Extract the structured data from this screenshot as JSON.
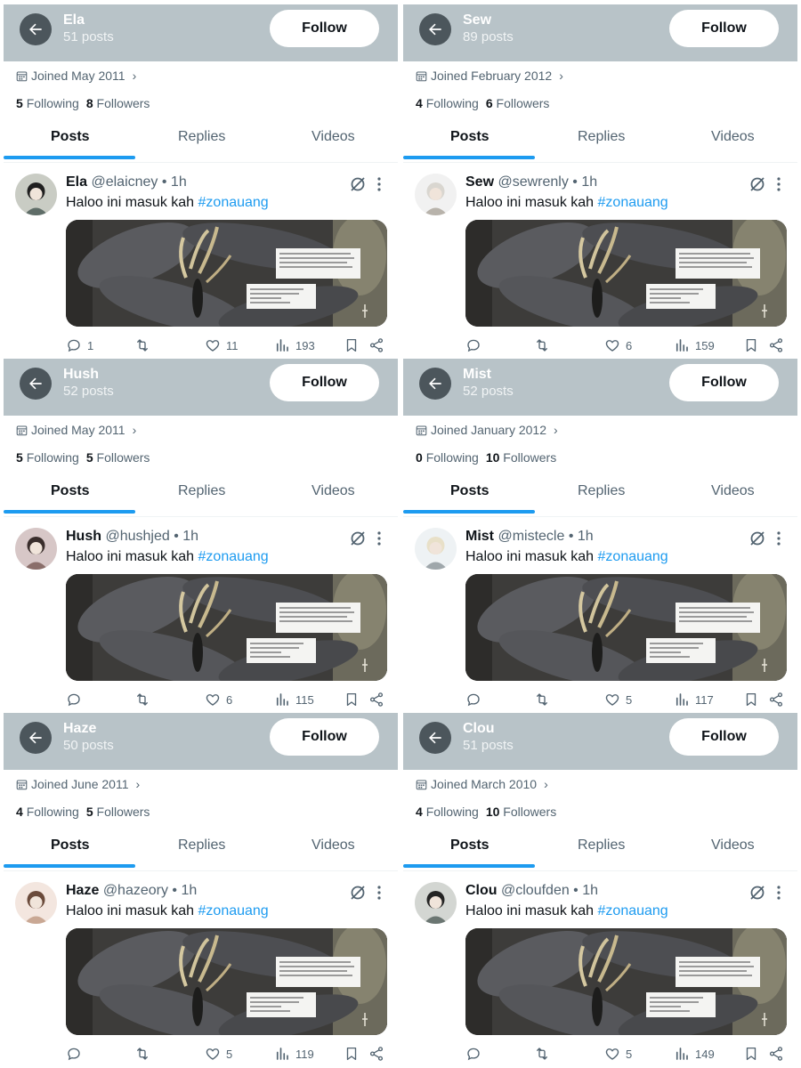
{
  "colors": {
    "header_bg": "#b8c3c8",
    "accent": "#1d9bf0",
    "secondary_text": "#536471"
  },
  "common": {
    "follow_label": "Follow",
    "tabs": [
      "Posts",
      "Replies",
      "Videos"
    ],
    "post_time": "1h",
    "post_body": "Haloo ini masuk kah ",
    "hashtag": "#zonauang",
    "following_word": "Following",
    "followers_word": "Followers"
  },
  "profiles": [
    {
      "name": "Ela",
      "posts": "51 posts",
      "joined": "Joined May 2011",
      "following": "5",
      "followers": "8",
      "handle": "@elaicney",
      "replies": "1",
      "likes": "11",
      "views": "193"
    },
    {
      "name": "Sew",
      "posts": "89 posts",
      "joined": "Joined February 2012",
      "following": "4",
      "followers": "6",
      "handle": "@sewrenly",
      "replies": "",
      "likes": "6",
      "views": "159"
    },
    {
      "name": "Hush",
      "posts": "52 posts",
      "joined": "Joined May 2011",
      "following": "5",
      "followers": "5",
      "handle": "@hushjed",
      "replies": "",
      "likes": "6",
      "views": "115"
    },
    {
      "name": "Mist",
      "posts": "52 posts",
      "joined": "Joined January 2012",
      "following": "0",
      "followers": "10",
      "handle": "@mistecle",
      "replies": "",
      "likes": "5",
      "views": "117"
    },
    {
      "name": "Haze",
      "posts": "50 posts",
      "joined": "Joined June 2011",
      "following": "4",
      "followers": "5",
      "handle": "@hazeory",
      "replies": "",
      "likes": "5",
      "views": "119"
    },
    {
      "name": "Clou",
      "posts": "51 posts",
      "joined": "Joined March 2010",
      "following": "4",
      "followers": "10",
      "handle": "@cloufden",
      "replies": "",
      "likes": "5",
      "views": "149"
    }
  ],
  "icons": [
    "back-arrow-icon",
    "calendar-icon",
    "chevron-right-icon",
    "grok-icon",
    "more-icon",
    "reply-icon",
    "retweet-icon",
    "like-icon",
    "views-icon",
    "bookmark-icon",
    "share-icon"
  ]
}
